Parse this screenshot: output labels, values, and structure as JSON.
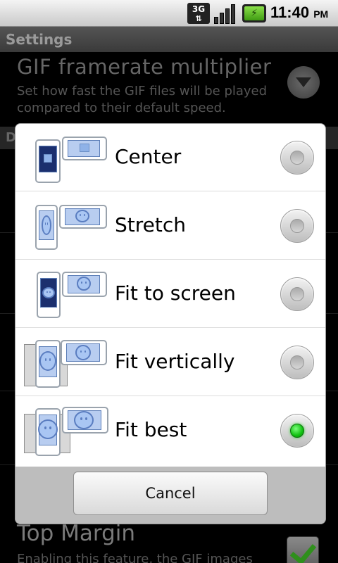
{
  "status_bar": {
    "network_label": "3G",
    "time": "11:40",
    "ampm": "PM",
    "icons": [
      "3g-data-icon",
      "signal-strength-icon",
      "battery-charging-icon"
    ]
  },
  "title_bar": {
    "title": "Settings"
  },
  "background_prefs": {
    "pref1_title": "GIF framerate multiplier",
    "pref1_summary": "Set how fast the GIF files will be played compared to their default speed.",
    "category_header": "D",
    "pref2_title": "Top Margin",
    "pref2_summary": "Enabling this feature, the GIF images",
    "pref2_checked": true
  },
  "dialog": {
    "options": [
      {
        "label": "Center",
        "selected": false
      },
      {
        "label": "Stretch",
        "selected": false
      },
      {
        "label": "Fit to screen",
        "selected": false
      },
      {
        "label": "Fit vertically",
        "selected": false
      },
      {
        "label": "Fit best",
        "selected": true
      }
    ],
    "cancel_label": "Cancel",
    "selected_color": "#10c010"
  }
}
